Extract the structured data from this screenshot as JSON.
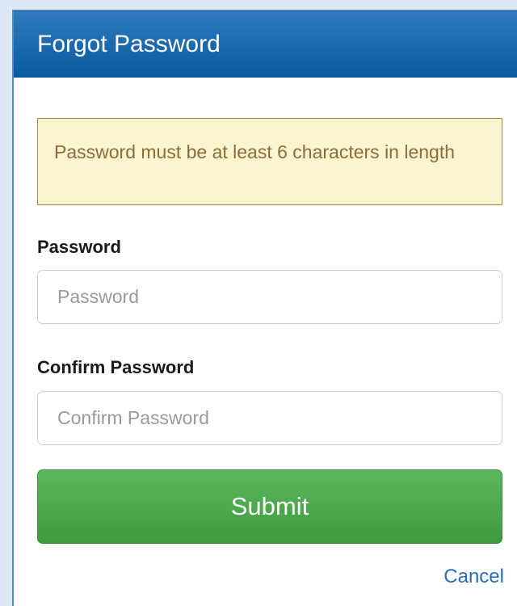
{
  "dialog": {
    "title": "Forgot Password"
  },
  "alert": {
    "message": "Password must be at least 6 characters in length"
  },
  "form": {
    "password_label": "Password",
    "password_placeholder": "Password",
    "password_value": "",
    "confirm_label": "Confirm Password",
    "confirm_placeholder": "Confirm Password",
    "confirm_value": "",
    "submit_label": "Submit",
    "cancel_label": "Cancel"
  },
  "colors": {
    "header": "#0a5a9e",
    "alert_bg": "#fcf3cf",
    "alert_text": "#8a6d3b",
    "submit_bg": "#5cb85c",
    "link": "#2a6db5"
  }
}
